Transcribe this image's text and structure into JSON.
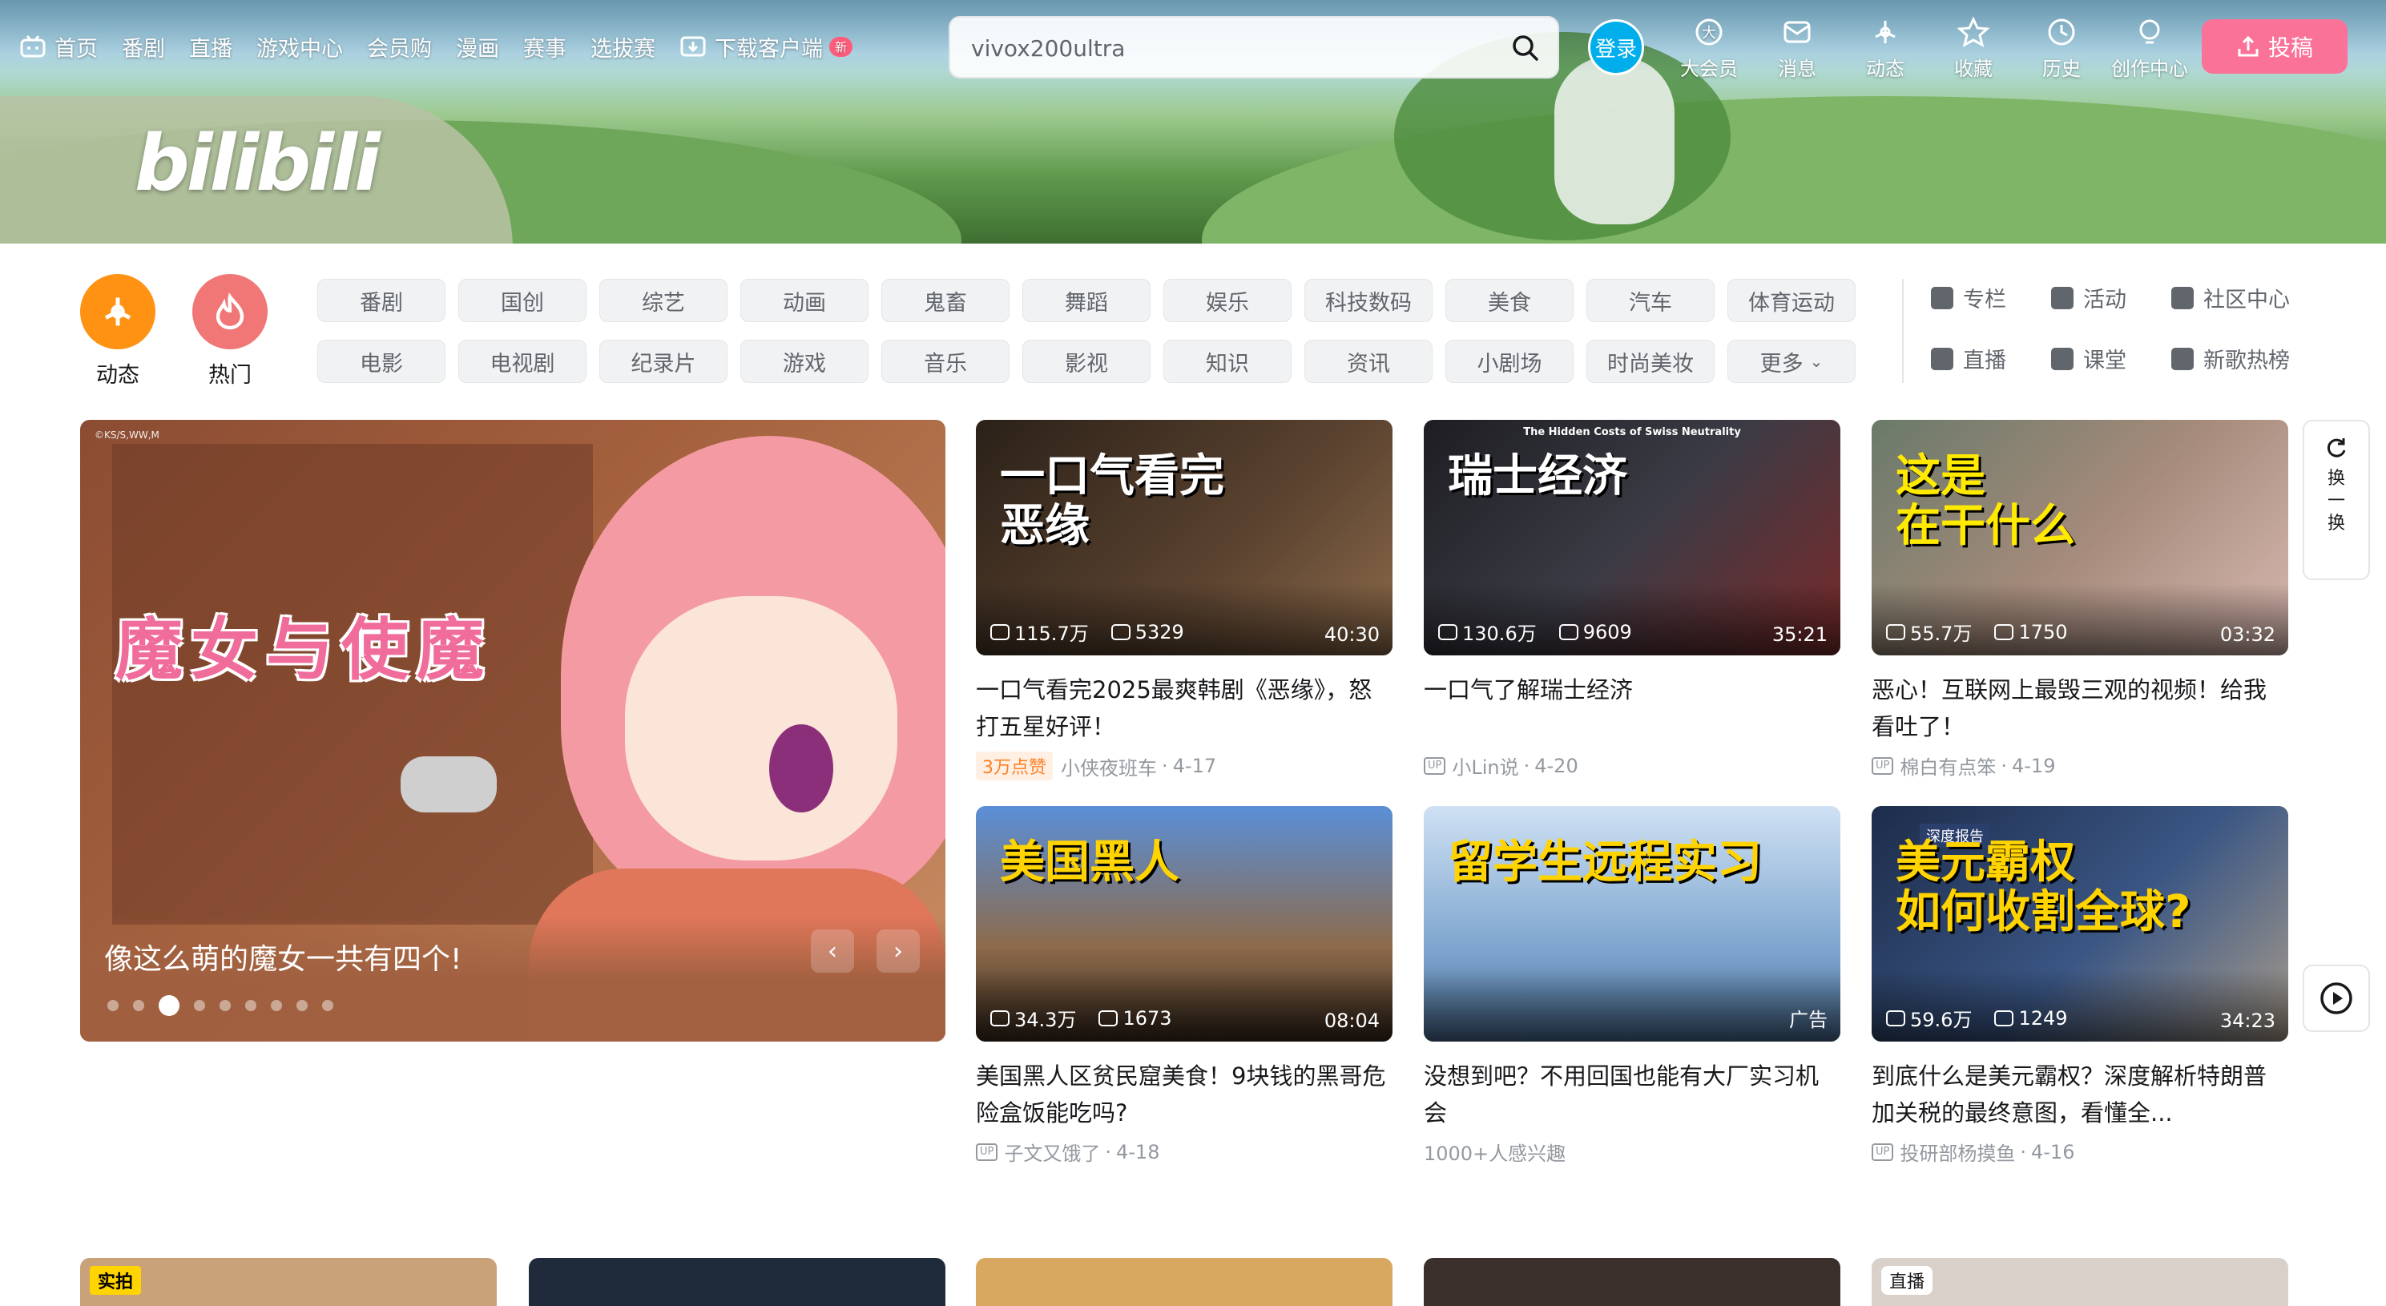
{
  "nav": {
    "items": [
      {
        "label": "首页",
        "icon": "bilibili-tv-icon"
      },
      {
        "label": "番剧"
      },
      {
        "label": "直播"
      },
      {
        "label": "游戏中心"
      },
      {
        "label": "会员购"
      },
      {
        "label": "漫画"
      },
      {
        "label": "赛事"
      },
      {
        "label": "选拔赛"
      },
      {
        "label": "下载客户端",
        "icon": "download-icon",
        "badge": "新"
      }
    ],
    "logo_text": "bilibili"
  },
  "search": {
    "value": "vivox200ultra",
    "placeholder": "vivox200ultra"
  },
  "user": {
    "login_label": "登录",
    "right_items": [
      {
        "label": "大会员",
        "icon": "vip-icon"
      },
      {
        "label": "消息",
        "icon": "message-icon"
      },
      {
        "label": "动态",
        "icon": "dynamic-icon"
      },
      {
        "label": "收藏",
        "icon": "star-icon"
      },
      {
        "label": "历史",
        "icon": "clock-icon"
      },
      {
        "label": "创作中心",
        "icon": "bulb-icon"
      }
    ],
    "upload_label": "投稿"
  },
  "quick": {
    "dynamic_label": "动态",
    "hot_label": "热门"
  },
  "channels": {
    "row1": [
      "番剧",
      "国创",
      "综艺",
      "动画",
      "鬼畜",
      "舞蹈",
      "娱乐",
      "科技数码",
      "美食",
      "汽车",
      "体育运动"
    ],
    "row2": [
      "电影",
      "电视剧",
      "纪录片",
      "游戏",
      "音乐",
      "影视",
      "知识",
      "资讯",
      "小剧场",
      "时尚美妆",
      "更多"
    ]
  },
  "links": {
    "row1": [
      "专栏",
      "活动",
      "社区中心"
    ],
    "row2": [
      "直播",
      "课堂",
      "新歌热榜"
    ]
  },
  "carousel": {
    "caption": "像这么萌的魔女一共有四个!",
    "art_text": "魔女与使魔",
    "copyright": "©KS/S,WW,M",
    "dot_count": 9,
    "active_dot": 2
  },
  "videos": [
    {
      "art": "一口气看完\n恶缘",
      "views": "115.7万",
      "danmaku": "5329",
      "duration": "40:30",
      "title": "一口气看完2025最爽韩剧《恶缘》，怒打五星好评！",
      "likes": "3万点赞",
      "author": "小侠夜班车",
      "date": "4-17",
      "show_up": false
    },
    {
      "art": "瑞士经济",
      "views": "130.6万",
      "danmaku": "9609",
      "duration": "35:21",
      "title": "一口气了解瑞士经济",
      "likes": "",
      "author": "小Lin说",
      "date": "4-20",
      "show_up": true,
      "top_caption": "The Hidden Costs of Swiss Neutrality"
    },
    {
      "art": "这是\n在干什么",
      "views": "55.7万",
      "danmaku": "1750",
      "duration": "03:32",
      "title": "恶心！互联网上最毁三观的视频！给我看吐了！",
      "likes": "",
      "author": "棉白有点笨",
      "date": "4-19",
      "show_up": true
    },
    {
      "art": "美国黑人",
      "views": "34.3万",
      "danmaku": "1673",
      "duration": "08:04",
      "title": "美国黑人区贫民窟美食！9块钱的黑哥危险盒饭能吃吗?",
      "likes": "",
      "author": "子文又饿了",
      "date": "4-18",
      "show_up": true
    },
    {
      "art": "留学生远程实习",
      "views": "",
      "danmaku": "",
      "duration": "广告",
      "title": "没想到吧？不用回国也能有大厂实习机会",
      "likes": "",
      "author": "1000+人感兴趣",
      "date": "",
      "show_up": false
    },
    {
      "art": "美元霸权\n如何收割全球?",
      "views": "59.6万",
      "danmaku": "1249",
      "duration": "34:23",
      "title": "到底什么是美元霸权？深度解析特朗普加关税的最终意图，看懂全...",
      "likes": "",
      "author": "投研部杨摸鱼",
      "date": "4-16",
      "show_up": true,
      "tag": "深度报告"
    }
  ],
  "refresh": {
    "label": "换一换"
  },
  "peek": {
    "tag1": "实拍",
    "tag5": "直播"
  },
  "colors": {
    "brand_pink": "#fb7299",
    "brand_blue": "#00aeec",
    "orange": "#ff7f24"
  }
}
